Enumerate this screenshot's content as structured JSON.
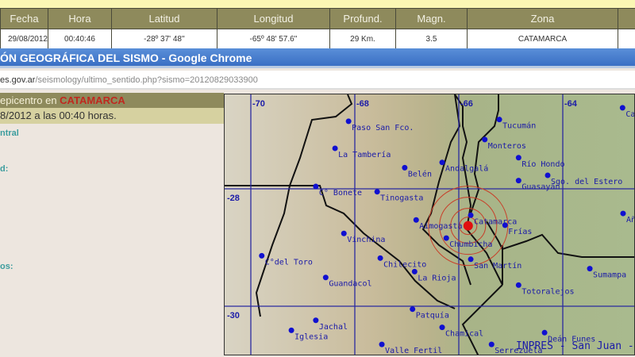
{
  "table": {
    "headers": [
      "Fecha",
      "Hora",
      "Latitud",
      "Longitud",
      "Profund.",
      "Magn.",
      "Zona",
      ""
    ],
    "row": [
      "29/08/2012",
      "00:40:46",
      "-28º 37' 48''",
      "-65º 48' 57.6''",
      "29 Km.",
      "3.5",
      "CATAMARCA",
      ""
    ]
  },
  "window": {
    "title": "ÓN GEOGRÁFICA DEL SISMO - Google Chrome"
  },
  "url": {
    "host": "es.gov.ar",
    "path": "/seismology/ultimo_sentido.php?sismo=20120829033900"
  },
  "panel": {
    "epicenter_prefix": "epicentro en ",
    "epicenter_zone": "CATAMARCA",
    "datetime": "8/2012 a las 00:40 horas.",
    "labels": [
      "ntral",
      "d:",
      "os:"
    ]
  },
  "map": {
    "lon_ticks": [
      "-70",
      "-68",
      "-66",
      "-64"
    ],
    "lat_ticks": [
      "-28",
      "-30"
    ],
    "credit": "INPRES - San Juan -",
    "epicenter": {
      "lat": -28.63,
      "lon": -65.82,
      "color": "#e01010"
    },
    "cities": [
      {
        "name": "Paso San Fco.",
        "lon": -68.12,
        "lat": -26.85
      },
      {
        "name": "La Tambería",
        "lon": -68.38,
        "lat": -27.31
      },
      {
        "name": "Belén",
        "lon": -67.04,
        "lat": -27.64
      },
      {
        "name": "C° Bonete",
        "lon": -68.75,
        "lat": -27.96
      },
      {
        "name": "Tinogasta",
        "lon": -67.57,
        "lat": -28.05
      },
      {
        "name": "Vinchina",
        "lon": -68.21,
        "lat": -28.76
      },
      {
        "name": "Andalgalá",
        "lon": -66.32,
        "lat": -27.55
      },
      {
        "name": "Tucumán",
        "lon": -65.22,
        "lat": -26.82
      },
      {
        "name": "Monteros",
        "lon": -65.5,
        "lat": -27.16
      },
      {
        "name": "Río Hondo",
        "lon": -64.85,
        "lat": -27.47
      },
      {
        "name": "Sgo. del Estero",
        "lon": -64.29,
        "lat": -27.77
      },
      {
        "name": "Guasayán",
        "lon": -64.85,
        "lat": -27.86
      },
      {
        "name": "Catamarca",
        "lon": -65.77,
        "lat": -28.45
      },
      {
        "name": "Frías",
        "lon": -65.11,
        "lat": -28.62
      },
      {
        "name": "Aimogasta",
        "lon": -66.82,
        "lat": -28.53
      },
      {
        "name": "Chumbicha",
        "lon": -66.24,
        "lat": -28.84
      },
      {
        "name": "San Martín",
        "lon": -65.77,
        "lat": -29.2
      },
      {
        "name": "Chilecito",
        "lon": -67.51,
        "lat": -29.18
      },
      {
        "name": "La Rioja",
        "lon": -66.85,
        "lat": -29.41
      },
      {
        "name": "C°del Toro",
        "lon": -69.79,
        "lat": -29.14
      },
      {
        "name": "Guandacol",
        "lon": -68.56,
        "lat": -29.51
      },
      {
        "name": "Jachal",
        "lon": -68.75,
        "lat": -30.24
      },
      {
        "name": "Iglesia",
        "lon": -69.22,
        "lat": -30.41
      },
      {
        "name": "Patquía",
        "lon": -66.89,
        "lat": -30.05
      },
      {
        "name": "Chamical",
        "lon": -66.32,
        "lat": -30.36
      },
      {
        "name": "Valle Fertil",
        "lon": -67.48,
        "lat": -30.65
      },
      {
        "name": "Serrezuela",
        "lon": -65.37,
        "lat": -30.65
      },
      {
        "name": "Deán Funes",
        "lon": -64.35,
        "lat": -30.45
      },
      {
        "name": "Totoralejos",
        "lon": -64.85,
        "lat": -29.64
      },
      {
        "name": "Sumampa",
        "lon": -63.48,
        "lat": -29.36
      },
      {
        "name": "Añ",
        "lon": -62.84,
        "lat": -28.42
      },
      {
        "name": "Ca",
        "lon": -62.85,
        "lat": -26.62
      }
    ]
  }
}
